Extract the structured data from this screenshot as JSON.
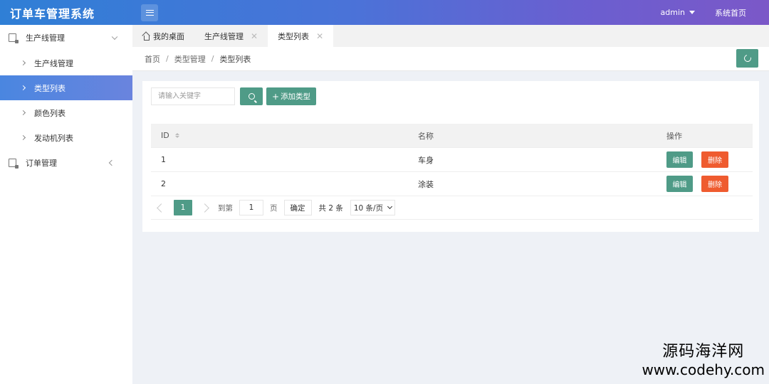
{
  "app": {
    "title": "订单车管理系统"
  },
  "header": {
    "user": "admin",
    "home_link": "系统首页"
  },
  "sidebar": {
    "groups": [
      {
        "label": "生产线管理",
        "items": [
          {
            "label": "生产线管理"
          },
          {
            "label": "类型列表",
            "active": true
          },
          {
            "label": "颜色列表"
          },
          {
            "label": "发动机列表"
          }
        ]
      },
      {
        "label": "订单管理"
      }
    ]
  },
  "tabs": [
    {
      "label": "我的桌面",
      "icon": "home-icon"
    },
    {
      "label": "生产线管理",
      "closable": true
    },
    {
      "label": "类型列表",
      "closable": true,
      "active": true
    }
  ],
  "breadcrumb": [
    "首页",
    "类型管理",
    "类型列表"
  ],
  "toolbar": {
    "search_placeholder": "请输入关键字",
    "add_label": "添加类型",
    "add_prefix": "+"
  },
  "table": {
    "columns": [
      "ID",
      "名称",
      "操作"
    ],
    "rows": [
      {
        "id": "1",
        "name": "车身"
      },
      {
        "id": "2",
        "name": "涂装"
      }
    ],
    "edit_label": "编辑",
    "delete_label": "删除"
  },
  "pagination": {
    "current_page": "1",
    "goto_label": "到第",
    "goto_value": "1",
    "page_unit": "页",
    "confirm_label": "确定",
    "total_text": "共 2 条",
    "page_size": "10 条/页"
  },
  "watermark": {
    "name": "源码海洋网",
    "url": "www.codehy.com"
  },
  "colors": {
    "primary": "#4f9b87",
    "danger": "#ef5b2f",
    "header_start": "#2f7fd6",
    "header_end": "#7b58c8"
  }
}
